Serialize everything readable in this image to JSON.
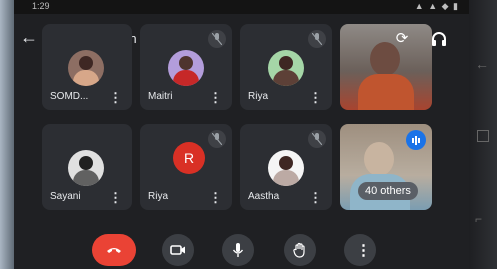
{
  "statusbar": {
    "left": "1:29",
    "right": "▲ ▲ ◆ ▮"
  },
  "header": {
    "meeting_code": "woi-kqux-pxn",
    "chevron": "▸"
  },
  "participants": [
    {
      "name": "SOMD...",
      "muted": true
    },
    {
      "name": "Maitri",
      "muted": true
    },
    {
      "name": "Riya",
      "muted": true
    },
    {
      "name": "Sayani",
      "muted": true
    },
    {
      "name": "Riya",
      "muted": true,
      "initial": "R"
    },
    {
      "name": "Aastha",
      "muted": true
    }
  ],
  "others_tile": {
    "label": "40 others"
  },
  "controls": {
    "end_call": "end-call",
    "camera": "camera",
    "mic": "mic",
    "raise_hand": "raise-hand",
    "more": "⋮"
  },
  "colors": {
    "end_call": "#ea4335",
    "accent": "#1a73e8",
    "letter_avatar": "#d93025"
  }
}
